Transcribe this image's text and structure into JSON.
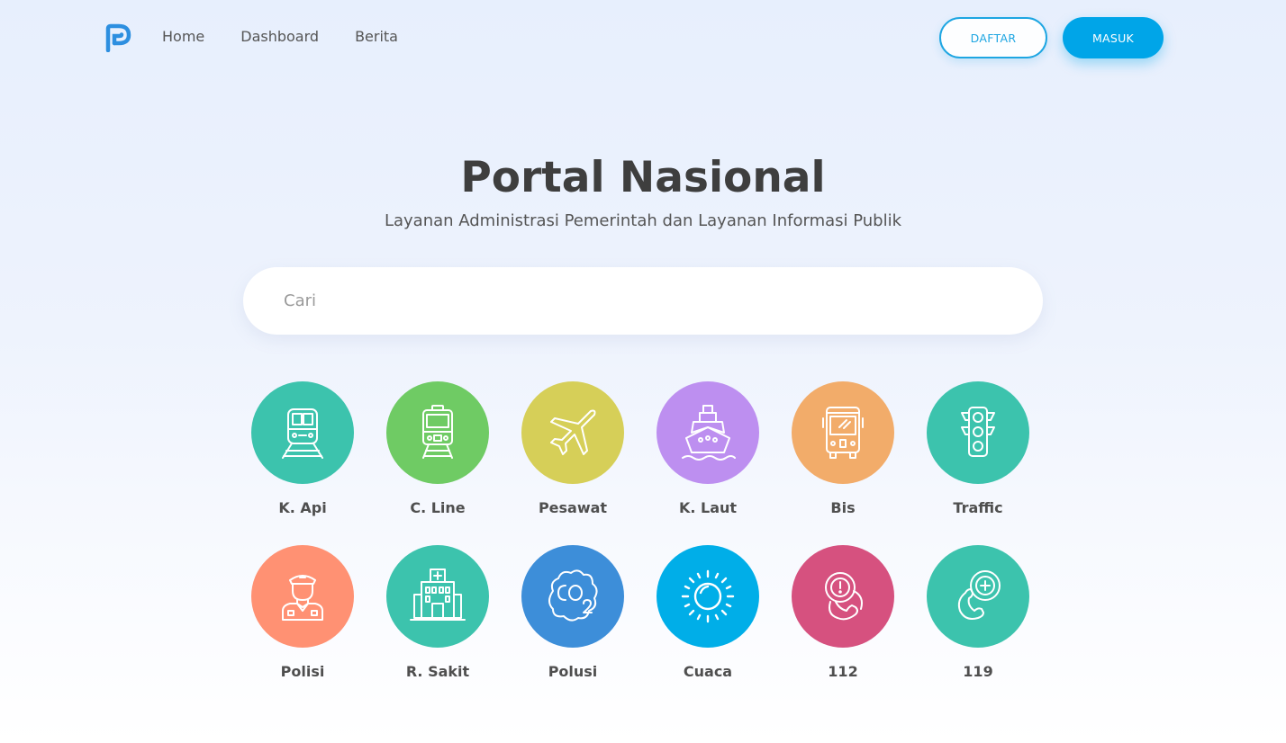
{
  "nav": {
    "logo_icon": "portal-p-logo",
    "links": [
      {
        "label": "Home"
      },
      {
        "label": "Dashboard"
      },
      {
        "label": "Berita"
      }
    ],
    "daftar_label": "DAFTAR",
    "masuk_label": "MASUK"
  },
  "hero": {
    "title": "Portal Nasional",
    "subtitle": "Layanan Administrasi Pemerintah dan Layanan Informasi Publik"
  },
  "search": {
    "placeholder": "Cari",
    "value": ""
  },
  "colors": {
    "accent": "#00a5e8",
    "logo": "#2d8fe0"
  },
  "services": [
    {
      "label": "K. Api",
      "icon": "train-icon",
      "color": "#3cc3ad"
    },
    {
      "label": "C. Line",
      "icon": "commuter-line-icon",
      "color": "#6fcb64"
    },
    {
      "label": "Pesawat",
      "icon": "airplane-icon",
      "color": "#d6cf58"
    },
    {
      "label": "K. Laut",
      "icon": "ship-icon",
      "color": "#bd8ff0"
    },
    {
      "label": "Bis",
      "icon": "bus-icon",
      "color": "#f2ac6a"
    },
    {
      "label": "Traffic",
      "icon": "traffic-light-icon",
      "color": "#3cc3ad"
    },
    {
      "label": "Polisi",
      "icon": "police-officer-icon",
      "color": "#ff9173"
    },
    {
      "label": "R. Sakit",
      "icon": "hospital-icon",
      "color": "#3cc3ad"
    },
    {
      "label": "Polusi",
      "icon": "co2-pollution-icon",
      "color": "#3d8ed9"
    },
    {
      "label": "Cuaca",
      "icon": "sun-weather-icon",
      "color": "#00aee8"
    },
    {
      "label": "112",
      "icon": "emergency-phone-icon",
      "color": "#d6517f"
    },
    {
      "label": "119",
      "icon": "medical-phone-icon",
      "color": "#3cc3ad"
    }
  ]
}
